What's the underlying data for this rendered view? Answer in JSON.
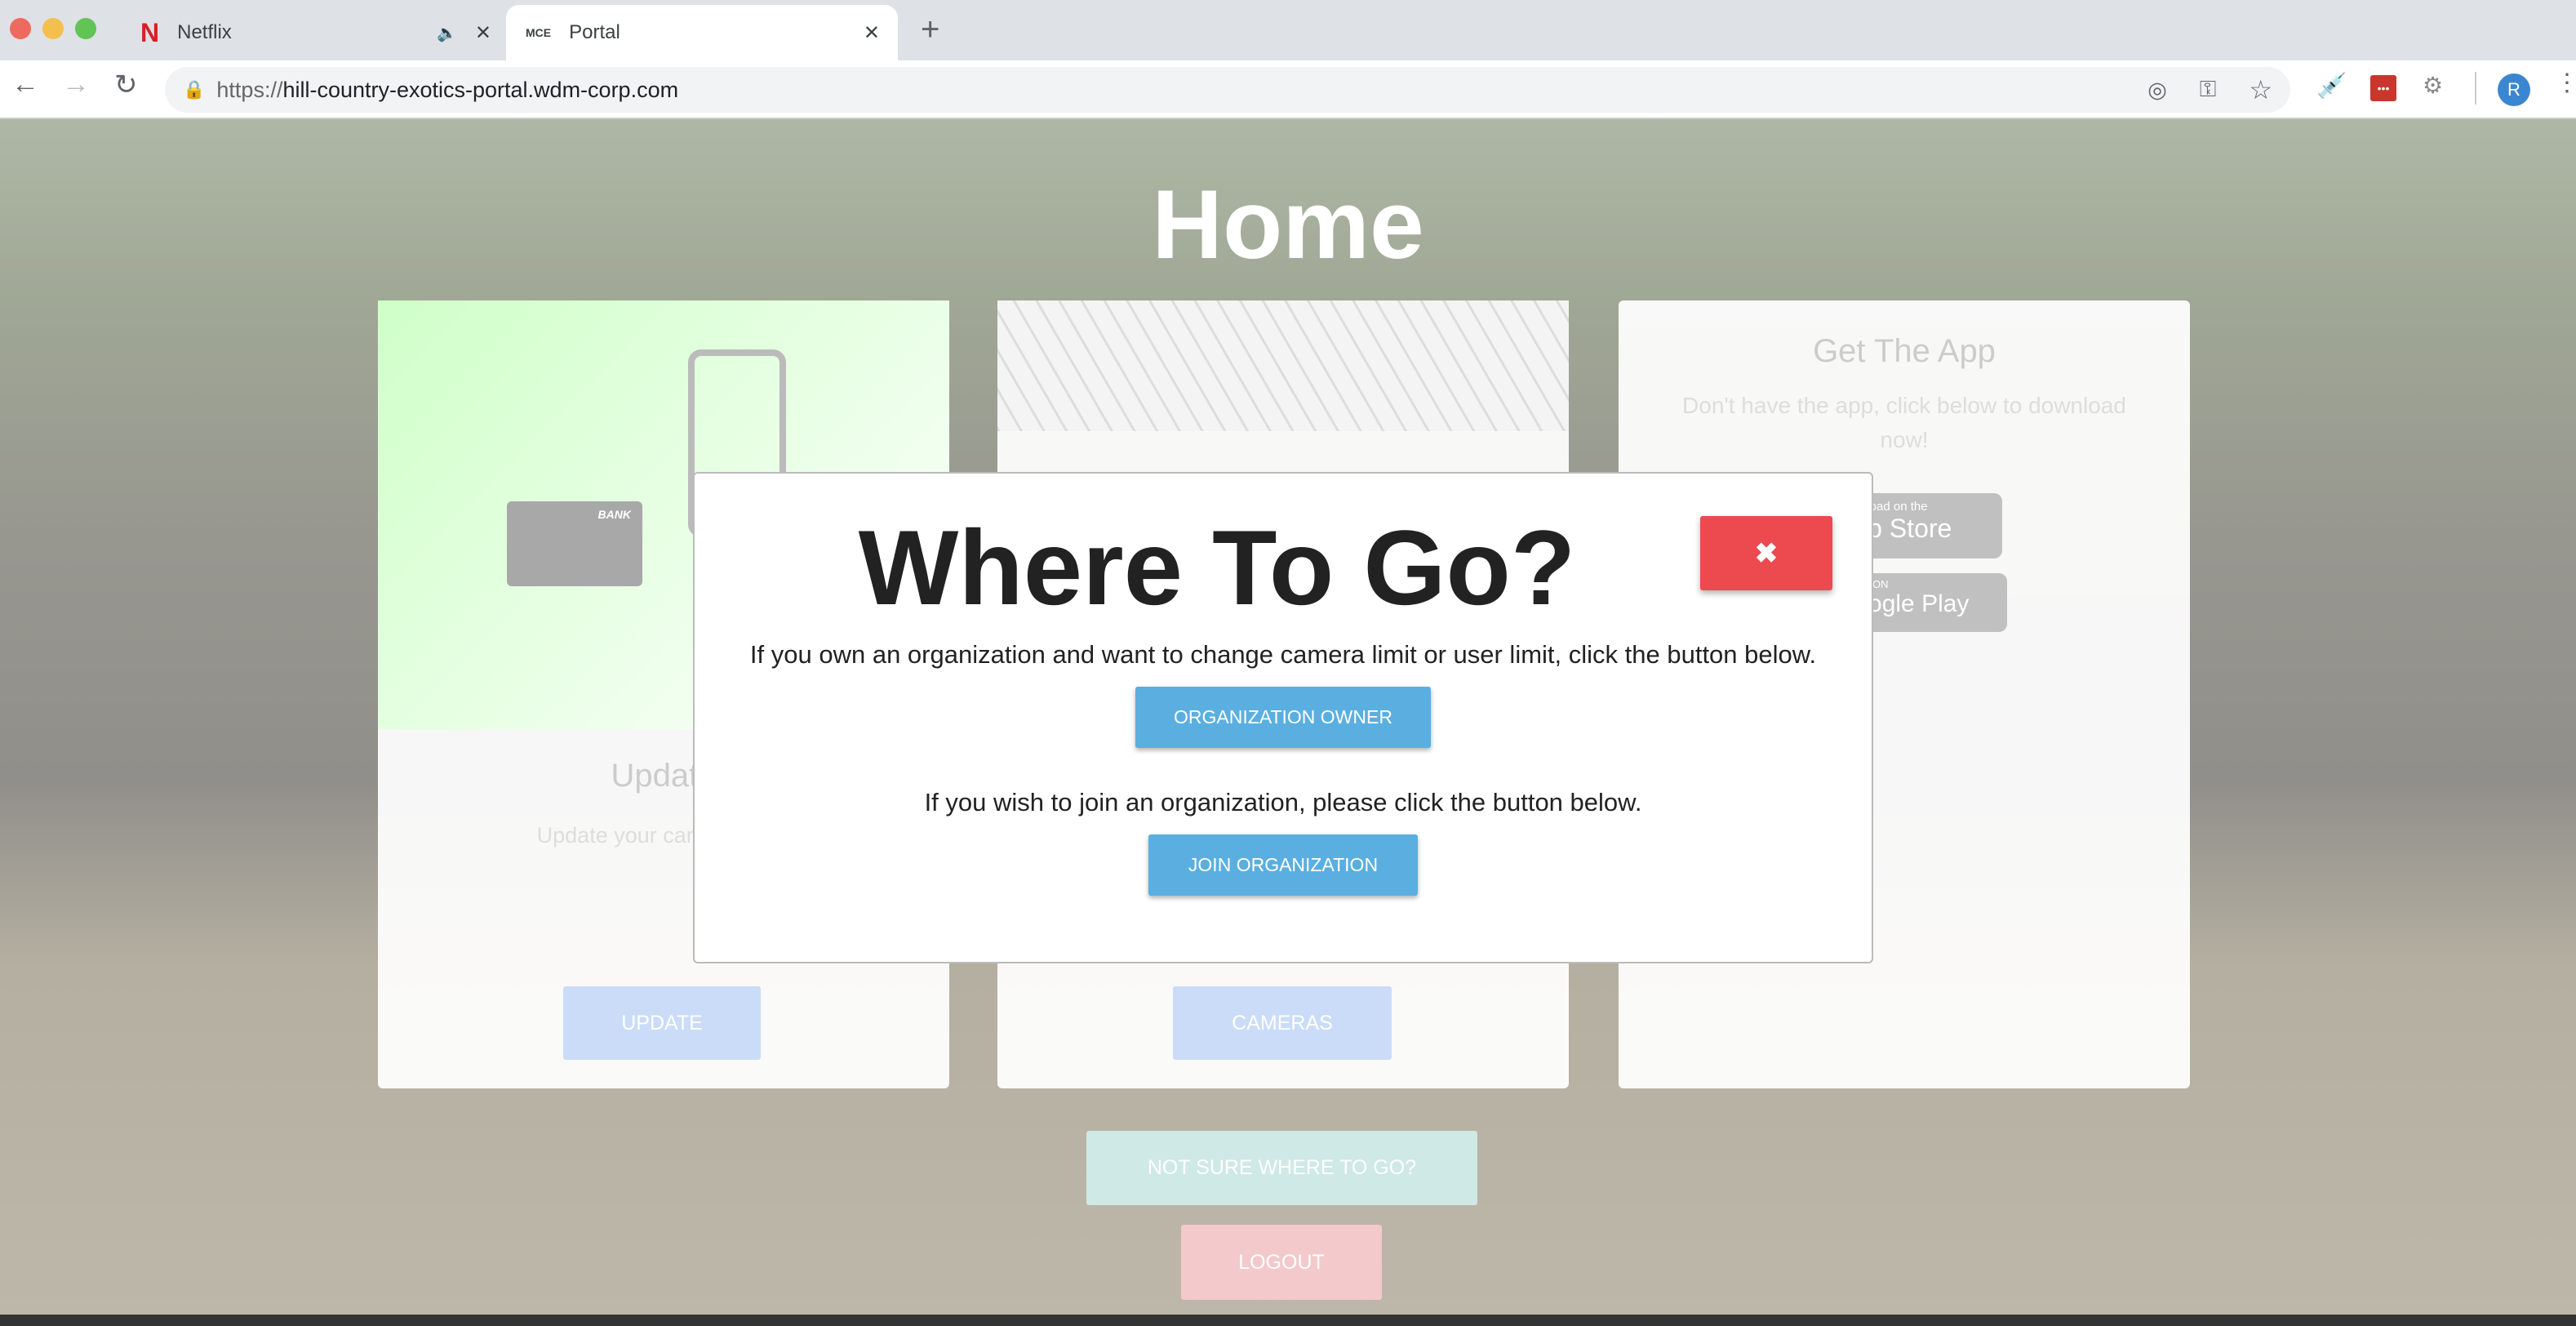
{
  "browser": {
    "tabs": [
      {
        "title": "Netflix",
        "icon": "netflix-icon",
        "audio": "speaker-icon"
      },
      {
        "title": "Portal",
        "icon": "mce-favicon",
        "active": true
      }
    ],
    "new_tab": "+",
    "url_scheme": "https://",
    "url_host": "hill-country-exotics-portal.wdm-corp.com",
    "profile_initial": "R"
  },
  "page": {
    "title": "Home",
    "cards": [
      {
        "title": "Update",
        "text": "Update your cameras and",
        "button": "UPDATE",
        "image_label": "BANK"
      },
      {
        "title": "",
        "button": "CAMERAS"
      },
      {
        "title": "Get The App",
        "text": "Don't have the app, click below to download now!",
        "app_store_small": "Download on the",
        "app_store": "App Store",
        "google_small": "GET IT ON",
        "google": "Google Play"
      }
    ],
    "not_sure": "NOT SURE WHERE TO GO?",
    "logout": "LOGOUT"
  },
  "modal": {
    "title": "Where To Go?",
    "close": "✖",
    "text1": "If you own an organization and want to change camera limit or user limit, click the button below.",
    "button1": "ORGANIZATION OWNER",
    "text2": "If you wish to join an organization, please click the button below.",
    "button2": "JOIN ORGANIZATION"
  },
  "colors": {
    "close": "#ec4a4f",
    "primary": "#5aafe0"
  }
}
